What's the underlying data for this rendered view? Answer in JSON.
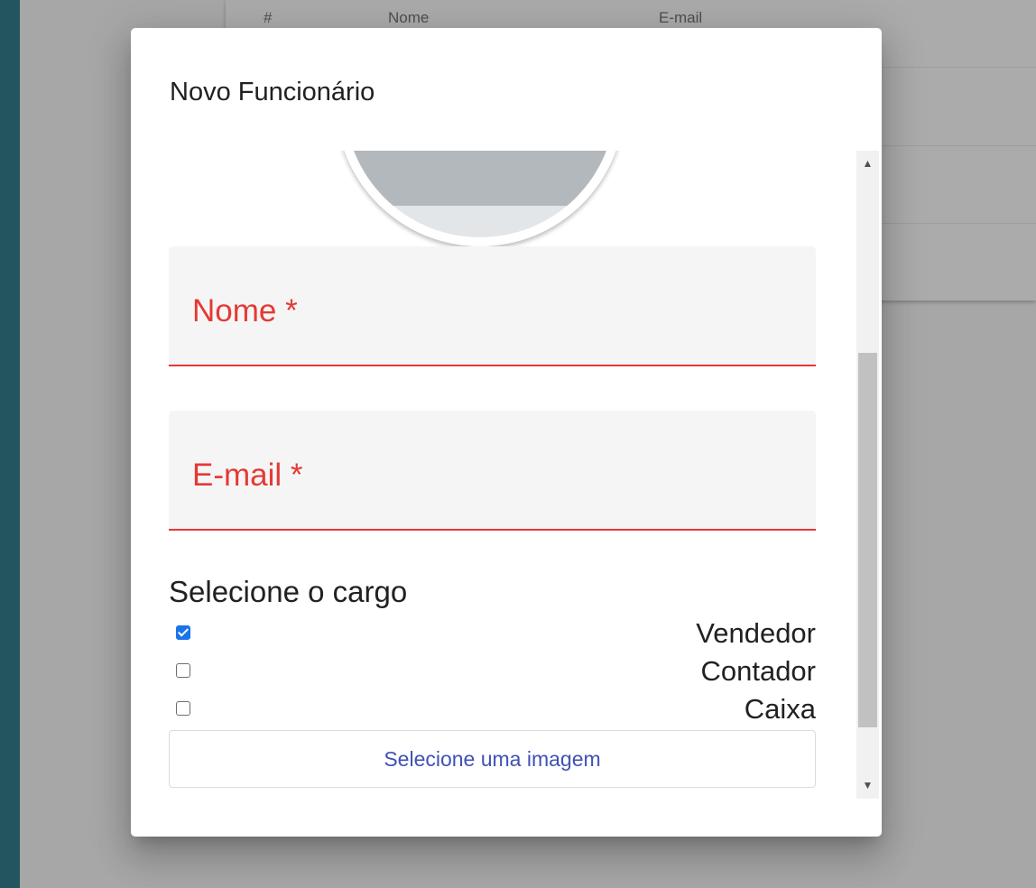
{
  "background": {
    "table_headers": [
      "#",
      "Nome",
      "E-mail"
    ]
  },
  "modal": {
    "title": "Novo Funcionário",
    "fields": {
      "nome_label": "Nome *",
      "email_label": "E-mail *"
    },
    "roles": {
      "label": "Selecione o cargo",
      "options": [
        {
          "name": "Vendedor",
          "checked": true
        },
        {
          "name": "Contador",
          "checked": false
        },
        {
          "name": "Caixa",
          "checked": false
        }
      ]
    },
    "upload_button_label": "Selecione uma imagem"
  },
  "colors": {
    "error": "#e53935",
    "accent": "#3f51b5",
    "checkbox_checked": "#1a73e8",
    "page_bg": "#235560"
  },
  "icons": {
    "scroll_up": "scroll-up-arrow-icon",
    "scroll_down": "scroll-down-arrow-icon",
    "check": "check-icon"
  }
}
